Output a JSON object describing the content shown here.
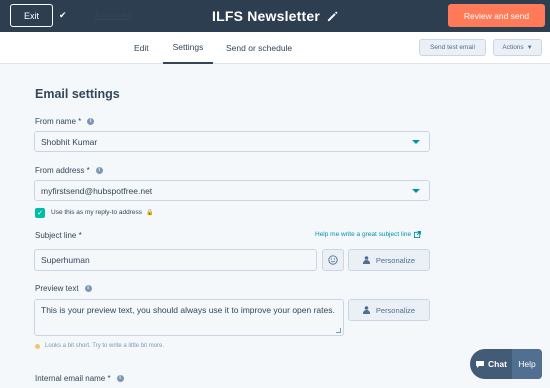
{
  "topbar": {
    "exit_label": "Exit",
    "autosaved_label": "Autosaved",
    "title": "ILFS Newsletter",
    "review_label": "Review and send"
  },
  "tabs": [
    {
      "label": "Edit",
      "active": false
    },
    {
      "label": "Settings",
      "active": true
    },
    {
      "label": "Send or schedule",
      "active": false
    }
  ],
  "toolbar": {
    "send_test_label": "Send test email",
    "actions_label": "Actions"
  },
  "settings": {
    "heading": "Email settings",
    "from_name": {
      "label": "From name *",
      "value": "Shobhit Kumar"
    },
    "from_address": {
      "label": "From address *",
      "value": "myfirstsend@hubspotfree.net"
    },
    "reply_to": {
      "label": "Use this as my reply-to address",
      "checked": true
    },
    "subject": {
      "label": "Subject line *",
      "value": "Superhuman",
      "help_link": "Help me write a great subject line"
    },
    "personalize_label": "Personalize",
    "preview": {
      "label": "Preview text",
      "value": "This is your preview text, you should always use it to improve your open rates.",
      "warning": "Looks a bit short. Try to write a little bit more."
    },
    "internal_name": {
      "label": "Internal email name *"
    }
  },
  "chat": {
    "chat_label": "Chat",
    "help_label": "Help"
  },
  "colors": {
    "topbar": "#2d3e50",
    "accent": "#ff7a59",
    "link": "#0091ae",
    "checkbox": "#00bda5"
  }
}
